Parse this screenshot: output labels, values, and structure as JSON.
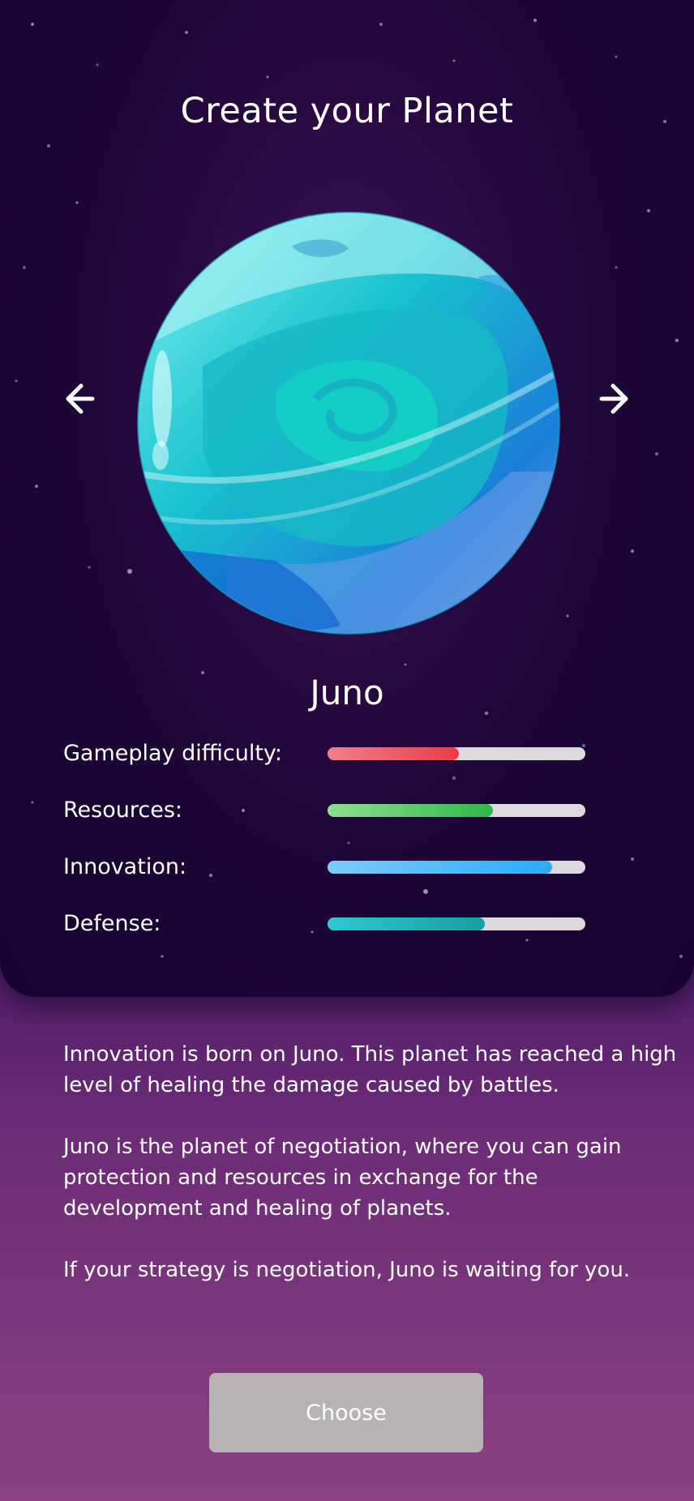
{
  "page": {
    "title": "Create your Planet"
  },
  "navigation": {
    "prev_icon": "arrow-left-icon",
    "next_icon": "arrow-right-icon"
  },
  "planet": {
    "name": "Juno",
    "image": "planet-juno-icon"
  },
  "stats": [
    {
      "label": "Gameplay difficulty:",
      "level": 0.51,
      "color_from": "#f07f8a",
      "color_to": "#ee3a45"
    },
    {
      "label": "Resources:",
      "level": 0.64,
      "color_from": "#8fe090",
      "color_to": "#2fb748"
    },
    {
      "label": "Innovation:",
      "level": 0.87,
      "color_from": "#7ccbfb",
      "color_to": "#2fa8f6"
    },
    {
      "label": "Defense:",
      "level": 0.61,
      "color_from": "#2ec8d0",
      "color_to": "#169ea0"
    }
  ],
  "description": [
    "Innovation is born on Juno. This planet has reached a high level of healing the damage caused by battles.",
    "Juno is the planet of negotiation, where you can gain protection and resources in exchange for the development and healing of planets.",
    "If your strategy is negotiation, Juno is waiting for you."
  ],
  "actions": {
    "choose_label": "Choose"
  },
  "colors": {
    "background_top": "#2a0c4a",
    "background_bottom": "#8a4280",
    "card": "#1b0634",
    "button": "#b6b3b4",
    "track": "#dcd9dd"
  }
}
